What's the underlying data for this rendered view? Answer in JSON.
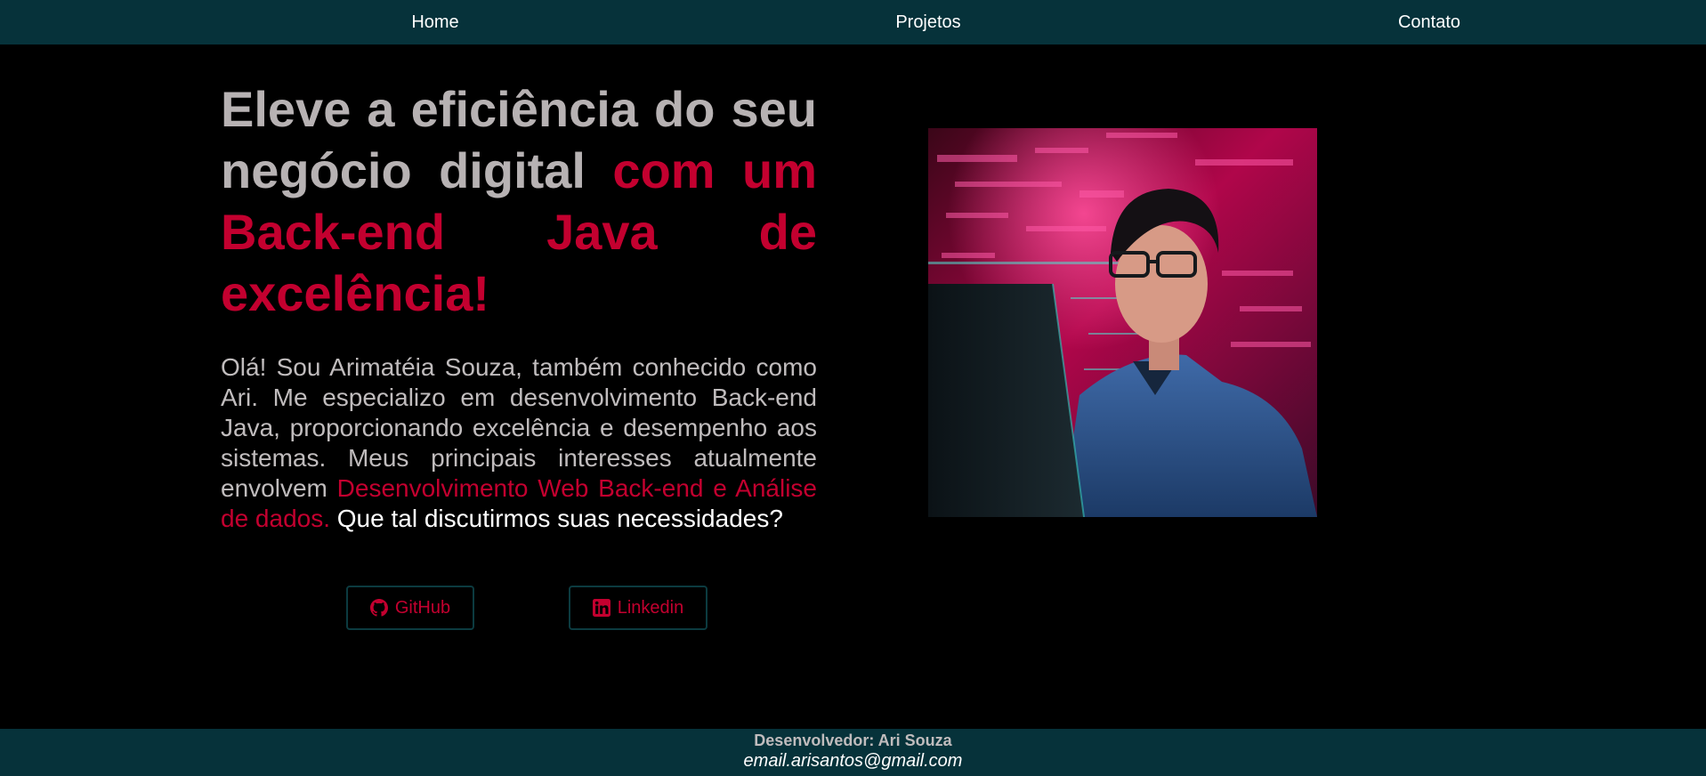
{
  "nav": {
    "home": "Home",
    "projects": "Projetos",
    "contact": "Contato"
  },
  "hero": {
    "headline_plain": "Eleve a eficiência do seu negócio digital ",
    "headline_accent": "com um Back-end Java de excelência!",
    "intro_part1": "Olá! Sou Arimatéia Souza, também conhecido como Ari. Me especializo em desenvolvimento Back-end Java, proporcionando excelência e desempenho aos sistemas. Meus principais interesses atualmente envolvem ",
    "intro_accent": "Desenvolvimento Web Back-end e Análise de dados.",
    "intro_part2": " Que tal discutirmos suas necessidades?"
  },
  "buttons": {
    "github_label": "GitHub",
    "github_icon": "github-icon",
    "linkedin_label": "Linkedin",
    "linkedin_icon": "linkedin-icon"
  },
  "footer": {
    "developer": "Desenvolvedor: Ari Souza",
    "email": "email.arisantos@gmail.com"
  },
  "colors": {
    "bar_background": "#06323a",
    "page_background": "#000000",
    "accent": "#c3002f",
    "text_gray": "#b7b2b3"
  }
}
